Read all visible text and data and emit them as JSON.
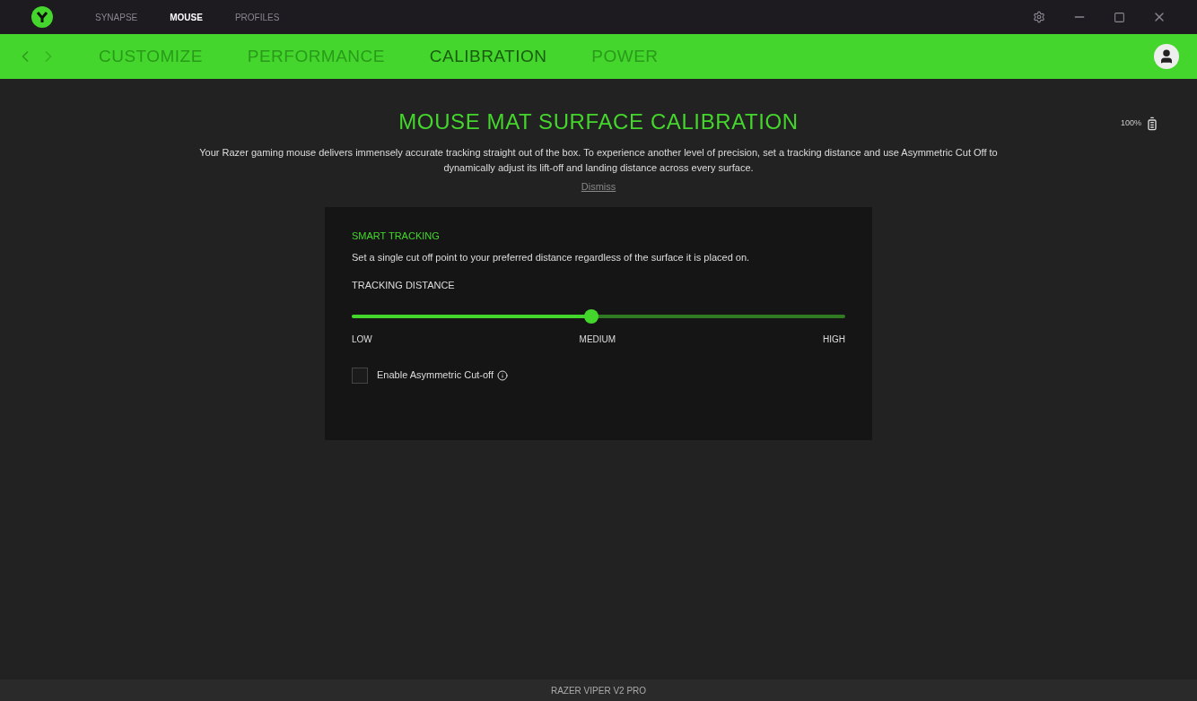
{
  "top_tabs": [
    {
      "label": "SYNAPSE",
      "selected": false
    },
    {
      "label": "MOUSE",
      "selected": true
    },
    {
      "label": "PROFILES",
      "selected": false
    }
  ],
  "nav_tabs": [
    {
      "label": "CUSTOMIZE",
      "selected": false
    },
    {
      "label": "PERFORMANCE",
      "selected": false
    },
    {
      "label": "CALIBRATION",
      "selected": true
    },
    {
      "label": "POWER",
      "selected": false
    }
  ],
  "battery": "100%",
  "title": "MOUSE MAT SURFACE CALIBRATION",
  "description": "Your Razer gaming mouse delivers immensely accurate tracking straight out of the box. To experience another level of precision, set a tracking distance and use Asymmetric Cut Off to dynamically adjust its lift-off and landing distance across every surface.",
  "dismiss": "Dismiss",
  "card": {
    "heading": "SMART TRACKING",
    "text": "Set a single cut off point to your preferred distance regardless of the surface it is placed on.",
    "slider_label": "TRACKING DISTANCE",
    "level": 0.5,
    "ticks": [
      "LOW",
      "MEDIUM",
      "HIGH"
    ],
    "checkbox": {
      "label": "Enable Asymmetric Cut-off",
      "checked": false
    }
  },
  "status_bar": "RAZER VIPER V2 PRO"
}
